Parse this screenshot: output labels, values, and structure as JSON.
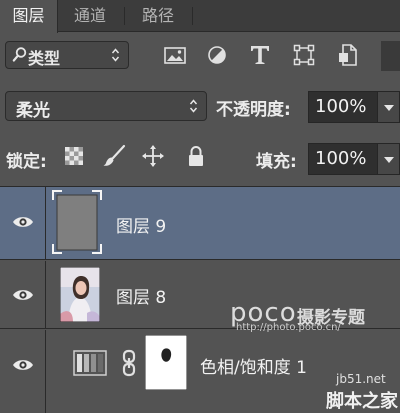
{
  "tabs": [
    {
      "label": "图层",
      "active": true
    },
    {
      "label": "通道",
      "active": false
    },
    {
      "label": "路径",
      "active": false
    }
  ],
  "filter": {
    "kind_label": "类型"
  },
  "filter_icons": [
    "image-filter-icon",
    "adjustment-filter-icon",
    "type-filter-icon",
    "shape-filter-icon",
    "smart-object-filter-icon"
  ],
  "blend": {
    "mode": "柔光"
  },
  "opacity": {
    "label": "不透明度:",
    "value": "100%"
  },
  "lock": {
    "label": "锁定:"
  },
  "lock_icons": [
    "lock-transparent-pixels-icon",
    "lock-image-pixels-icon",
    "lock-position-icon",
    "lock-all-icon"
  ],
  "fill": {
    "label": "填充:",
    "value": "100%"
  },
  "layers": [
    {
      "name": "图层 9",
      "selected": true,
      "thumbnail": "gray"
    },
    {
      "name": "图层 8",
      "selected": false,
      "thumbnail": "photo"
    },
    {
      "name": "色相/饱和度 1",
      "selected": false,
      "thumbnail": "adjustment-with-mask"
    }
  ],
  "watermarks": {
    "poco_brand": "poco",
    "poco_title": "摄影专题",
    "poco_url": "http://photo.poco.cn/",
    "jb51_url": "jb51.net",
    "jb51_name": "脚本之家"
  },
  "colors": {
    "selected_row": "#5d6d86",
    "panel_bg": "#535353",
    "tab_bar": "#3c3c3c"
  }
}
